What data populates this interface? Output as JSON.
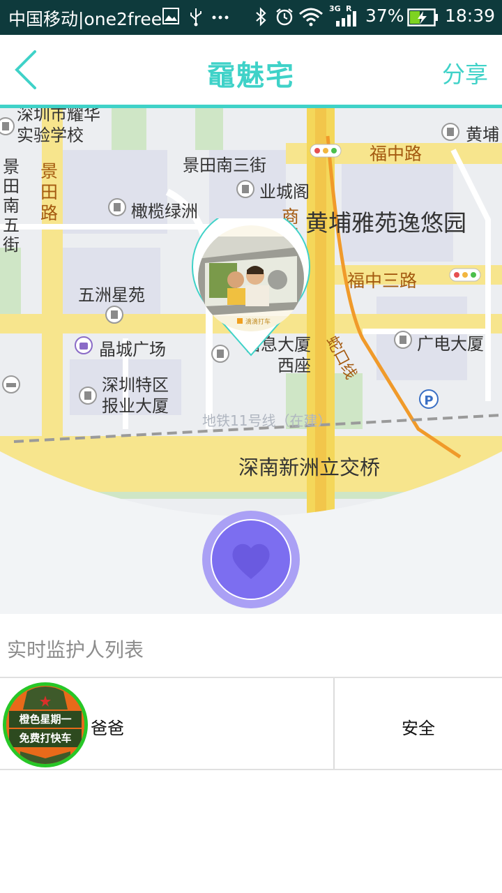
{
  "status_bar": {
    "carrier": "中国移动|one2free",
    "network_label": "3G",
    "roaming_label": "R",
    "battery": "37%",
    "time": "18:39"
  },
  "header": {
    "title": "黿魅宅",
    "share_label": "分享"
  },
  "map": {
    "pois": [
      "深圳市耀华实验学校",
      "景田南三街",
      "业城阁",
      "橄榄绿洲",
      "五洲星苑",
      "晶城广场",
      "深圳特区报业大厦",
      "信息大厦西座",
      "广电大厦",
      "黄埔",
      "黄埔雅苑逸悠园"
    ],
    "roads": [
      "景田南五街",
      "景田路",
      "福中路",
      "福中三路",
      "商报",
      "蛇口线",
      "深南新洲立交桥",
      "地铁11号线（在建）"
    ],
    "photo_caption": "滴滴打车"
  },
  "heart_button": {
    "icon": "heart-icon",
    "color": "#7c6ef0"
  },
  "guardians": {
    "header": "实时监护人列表",
    "items": [
      {
        "name": "爸爸",
        "status": "安全",
        "avatar_text_top": "橙色星期一",
        "avatar_text_bottom": "免费打快车"
      }
    ]
  },
  "colors": {
    "accent": "#3fd2c8",
    "statusbar_bg": "#0e3a3c",
    "heart": "#7c6ef0"
  }
}
